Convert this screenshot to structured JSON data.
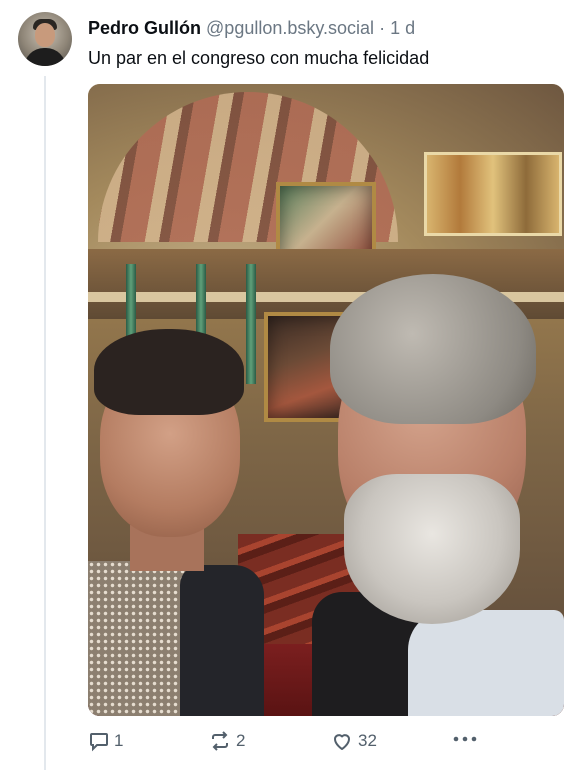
{
  "post": {
    "author_name": "Pedro Gullón",
    "handle": "@pgullon.bsky.social",
    "separator": "·",
    "age": "1 d",
    "text": "Un par en el congreso con mucha felicidad"
  },
  "actions": {
    "reply_count": "1",
    "repost_count": "2",
    "like_count": "32"
  },
  "icons": [
    "avatar",
    "reply-icon",
    "repost-icon",
    "like-icon",
    "more-icon"
  ],
  "colors": {
    "text": "#0f1419",
    "muted": "#6b7783",
    "thread_line": "#e3e8ed"
  }
}
